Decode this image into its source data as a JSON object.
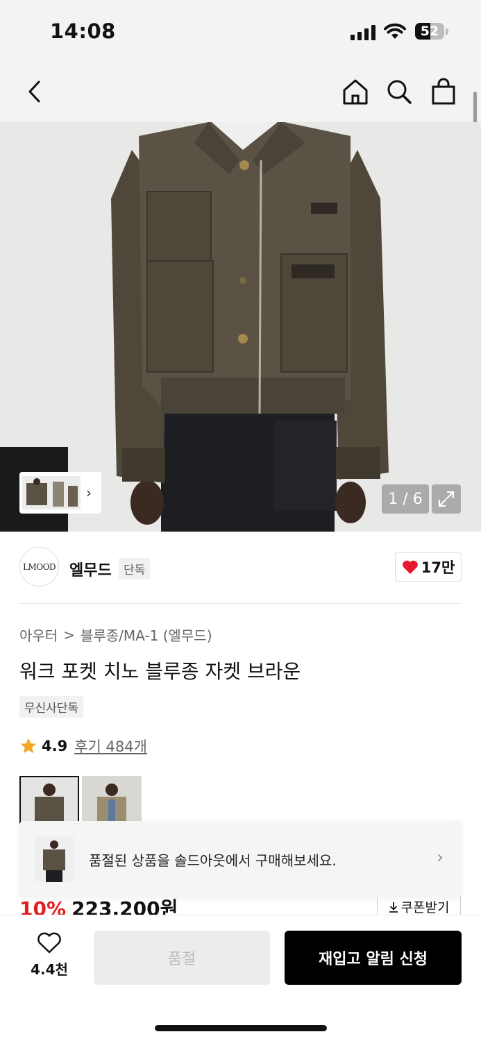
{
  "status_bar": {
    "time": "14:08",
    "battery": "52"
  },
  "gallery": {
    "counter": "1 / 6"
  },
  "brand": {
    "logo_text": "LMOOD",
    "name": "엘무드",
    "tag": "단독",
    "likes": "17만"
  },
  "product": {
    "breadcrumb": [
      "아우터",
      "블루종/MA-1 (엘무드)"
    ],
    "breadcrumb_sep": ">",
    "title": "워크 포켓 치노 블루종 자켓 브라운",
    "exclusive_badge": "무신사단독",
    "rating": "4.9",
    "reviews": "후기 484개"
  },
  "price": {
    "discount": "10%",
    "amount": "223,200원",
    "coupon": "쿠폰받기"
  },
  "soldout_banner": {
    "message": "품절된 상품을 솔드아웃에서 구매해보세요."
  },
  "bottom_bar": {
    "wish_count": "4.4천",
    "soldout_label": "품절",
    "restock_label": "재입고 알림 신청"
  },
  "colors": {
    "jacket": "#5a5244",
    "discount_red": "#e02020",
    "heart_red": "#e8192c"
  }
}
